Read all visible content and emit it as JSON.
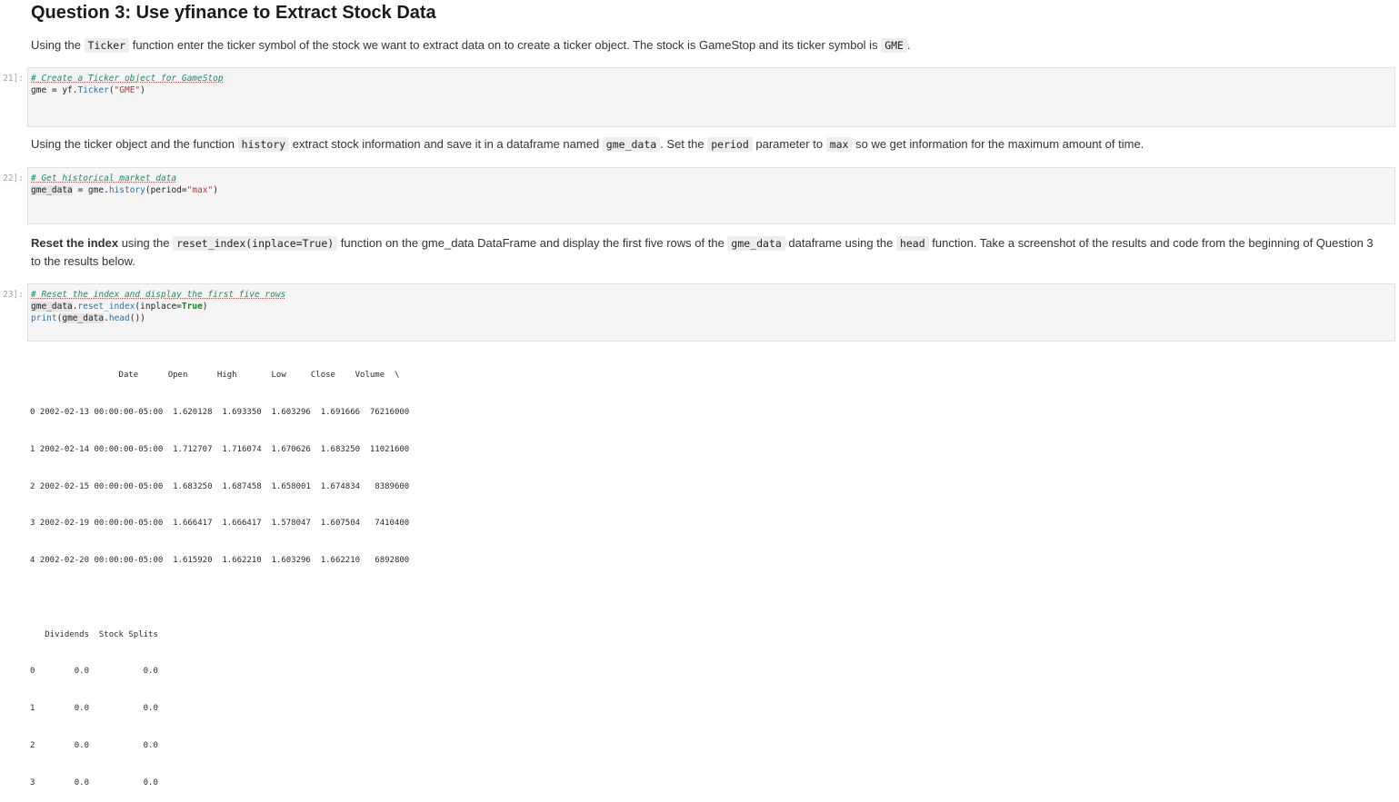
{
  "heading": "Question 3: Use yfinance to Extract Stock Data",
  "para1": {
    "t1": "Using the ",
    "c1": "Ticker",
    "t2": " function enter the ticker symbol of the stock we want to extract data on to create a ticker object. The stock is GameStop and its ticker symbol is ",
    "c2": "GME",
    "t3": "."
  },
  "cell21": {
    "prompt": "21]:",
    "comment": "# Create a Ticker object for GameStop",
    "l2a": "gme = yf.",
    "l2fn": "Ticker",
    "l2b": "(",
    "l2str": "\"GME\"",
    "l2c": ")"
  },
  "para2": {
    "t1": "Using the ticker object and the function ",
    "c1": "history",
    "t2": " extract stock information and save it in a dataframe named ",
    "c2": "gme_data",
    "t3": ". Set the ",
    "c3": "period",
    "t4": " parameter to ",
    "c4": "max",
    "t5": " so we get information for the maximum amount of time."
  },
  "cell22": {
    "prompt": "22]:",
    "comment": "# Get historical market data",
    "var": "gme_data",
    "l2a": " = gme.",
    "l2fn": "history",
    "l2b": "(period=",
    "l2str": "\"max\"",
    "l2c": ")"
  },
  "para3": {
    "bold": "Reset the index",
    "t1": " using the ",
    "c1": "reset_index(inplace=True)",
    "t2": " function on the gme_data DataFrame and display the first five rows of the ",
    "c2": "gme_data",
    "t3": " dataframe using the ",
    "c3": "head",
    "t4": " function. Take a screenshot of the results and code from the beginning of Question 3 to the results below."
  },
  "cell23": {
    "prompt": "23]:",
    "comment": "# Reset the index and display the first five rows",
    "var1": "gme_data",
    "l2a": ".",
    "l2fn": "reset_index",
    "l2b": "(inplace=",
    "l2kw": "True",
    "l2c": ")",
    "l3fn": "print",
    "l3a": "(",
    "var2": "gme_data",
    "l3b": ".",
    "l3fn2": "head",
    "l3c": "())"
  },
  "output": {
    "header1": "                  Date      Open      High       Low     Close    Volume  \\",
    "rows1": [
      "0 2002-02-13 00:00:00-05:00  1.620128  1.693350  1.603296  1.691666  76216000",
      "1 2002-02-14 00:00:00-05:00  1.712707  1.716074  1.670626  1.683250  11021600",
      "2 2002-02-15 00:00:00-05:00  1.683250  1.687458  1.658001  1.674834   8389600",
      "3 2002-02-19 00:00:00-05:00  1.666417  1.666417  1.578047  1.607504   7410400",
      "4 2002-02-20 00:00:00-05:00  1.615920  1.662210  1.603296  1.662210   6892800"
    ],
    "header2": "   Dividends  Stock Splits",
    "rows2": [
      "0        0.0           0.0",
      "1        0.0           0.0",
      "2        0.0           0.0",
      "3        0.0           0.0"
    ]
  }
}
